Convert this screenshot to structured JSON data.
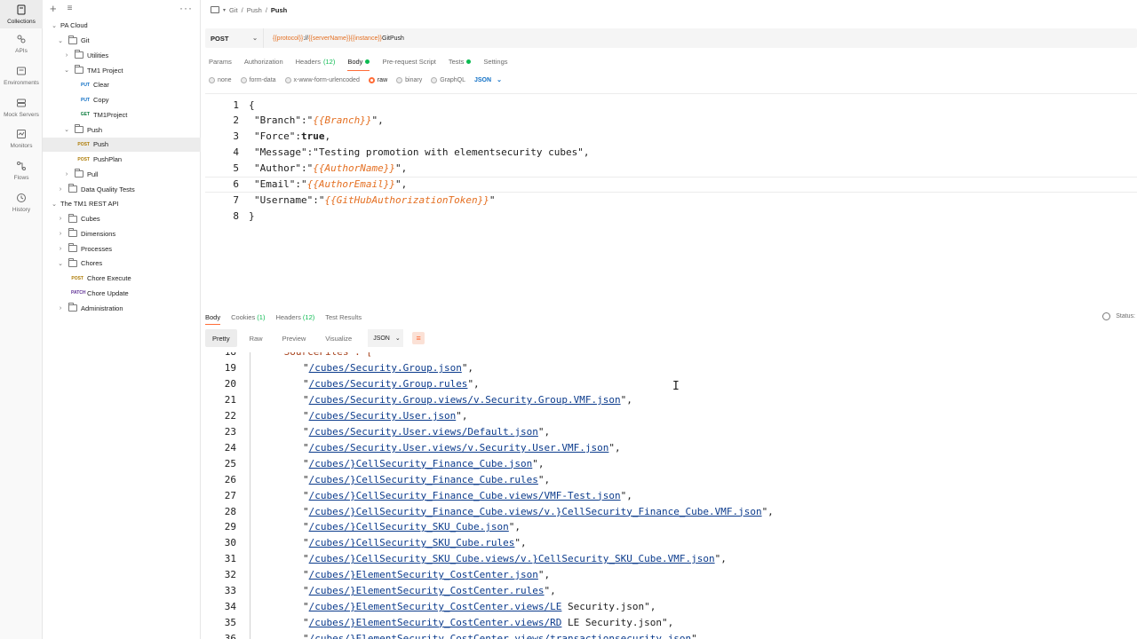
{
  "rail": {
    "items": [
      {
        "label": "Collections",
        "icon": "collections-icon"
      },
      {
        "label": "APIs",
        "icon": "apis-icon"
      },
      {
        "label": "Environments",
        "icon": "environments-icon"
      },
      {
        "label": "Mock Servers",
        "icon": "mock-servers-icon"
      },
      {
        "label": "Monitors",
        "icon": "monitors-icon"
      },
      {
        "label": "Flows",
        "icon": "flows-icon"
      },
      {
        "label": "History",
        "icon": "history-icon"
      }
    ]
  },
  "sidebar": {
    "tree": [
      {
        "label": "PA Cloud",
        "type": "collection",
        "depth": 0,
        "chevron": "v"
      },
      {
        "label": "Git",
        "type": "folder",
        "depth": 1,
        "chevron": "v"
      },
      {
        "label": "Utilities",
        "type": "folder",
        "depth": 2,
        "chevron": ">"
      },
      {
        "label": "TM1 Project",
        "type": "folder",
        "depth": 2,
        "chevron": "v"
      },
      {
        "label": "Clear",
        "type": "request",
        "method": "PUT",
        "depth": 3
      },
      {
        "label": "Copy",
        "type": "request",
        "method": "PUT",
        "depth": 3
      },
      {
        "label": "TM1Project",
        "type": "request",
        "method": "GET",
        "depth": 3
      },
      {
        "label": "Push",
        "type": "folder",
        "depth": 2,
        "chevron": "v"
      },
      {
        "label": "Push",
        "type": "request",
        "method": "POST",
        "depth": 3,
        "selected": true
      },
      {
        "label": "PushPlan",
        "type": "request",
        "method": "POST",
        "depth": 3
      },
      {
        "label": "Pull",
        "type": "folder",
        "depth": 2,
        "chevron": ">"
      },
      {
        "label": "Data Quality Tests",
        "type": "folder",
        "depth": 1,
        "chevron": ">"
      },
      {
        "label": "The TM1 REST API",
        "type": "collection",
        "depth": 0,
        "chevron": "v"
      },
      {
        "label": "Cubes",
        "type": "folder",
        "depth": 1,
        "chevron": ">"
      },
      {
        "label": "Dimensions",
        "type": "folder",
        "depth": 1,
        "chevron": ">"
      },
      {
        "label": "Processes",
        "type": "folder",
        "depth": 1,
        "chevron": ">"
      },
      {
        "label": "Chores",
        "type": "folder",
        "depth": 1,
        "chevron": "v"
      },
      {
        "label": "Chore Execute",
        "type": "request",
        "method": "POST",
        "depth": 2
      },
      {
        "label": "Chore Update",
        "type": "request",
        "method": "PATCH",
        "depth": 2
      },
      {
        "label": "Administration",
        "type": "folder",
        "depth": 1,
        "chevron": ">"
      }
    ]
  },
  "breadcrumb": {
    "part1": "Git",
    "sep": "/",
    "part2": "Push",
    "current": "Push"
  },
  "request": {
    "method": "POST",
    "url_parts": [
      {
        "text": "{{protocol}}",
        "var": true
      },
      {
        "text": "://",
        "var": false
      },
      {
        "text": "{{serverName}}",
        "var": true
      },
      {
        "text": "{{instance}}",
        "var": true
      },
      {
        "text": "GitPush",
        "var": false
      }
    ],
    "tabs": [
      {
        "label": "Params"
      },
      {
        "label": "Authorization"
      },
      {
        "label": "Headers",
        "count": "(12)"
      },
      {
        "label": "Body",
        "dot": true,
        "active": true
      },
      {
        "label": "Pre-request Script"
      },
      {
        "label": "Tests",
        "dot": true
      },
      {
        "label": "Settings"
      }
    ],
    "body_types": [
      "none",
      "form-data",
      "x-www-form-urlencoded",
      "raw",
      "binary",
      "GraphQL"
    ],
    "body_type_selected": "raw",
    "language": "JSON",
    "body_lines": [
      {
        "n": "1",
        "t": "{"
      },
      {
        "n": "2",
        "k": "\"Branch\"",
        "sep": ":",
        "q1": "\"",
        "v": "{{Branch}}",
        "q2": "\","
      },
      {
        "n": "3",
        "k": "\"Force\"",
        "sep": ":",
        "bool": "true",
        "end": ","
      },
      {
        "n": "4",
        "k": "\"Message\"",
        "sep": ":",
        "str": "\"Testing promotion with elementsecurity cubes\","
      },
      {
        "n": "5",
        "k": "\"Author\"",
        "sep": ":",
        "q1": "\"",
        "v": "{{AuthorName}}",
        "q2": "\","
      },
      {
        "n": "6",
        "k": "\"Email\"",
        "sep": ":",
        "q1": "\"",
        "v": "{{AuthorEmail}}",
        "q2": "\","
      },
      {
        "n": "7",
        "k": "\"Username\"",
        "sep": ":",
        "q1": "\"",
        "v": "{{GitHubAuthorizationToken}}",
        "q2": "\""
      },
      {
        "n": "8",
        "t": "}"
      }
    ]
  },
  "response": {
    "tabs": [
      {
        "label": "Body",
        "active": true
      },
      {
        "label": "Cookies",
        "count": "(1)"
      },
      {
        "label": "Headers",
        "count": "(12)"
      },
      {
        "label": "Test Results"
      }
    ],
    "status_label": "Status:",
    "views": [
      "Pretty",
      "Raw",
      "Preview",
      "Visualize"
    ],
    "view_selected": "Pretty",
    "format": "JSON",
    "first_line": {
      "n": "18",
      "t": "\"SourceFiles\": ["
    },
    "lines": [
      {
        "n": "19",
        "path": "/cubes/Security.Group.json",
        "end": "\","
      },
      {
        "n": "20",
        "path": "/cubes/Security.Group.rules",
        "end": "\","
      },
      {
        "n": "21",
        "path": "/cubes/Security.Group.views/v.Security.Group.VMF.json",
        "end": "\","
      },
      {
        "n": "22",
        "path": "/cubes/Security.User.json",
        "end": "\","
      },
      {
        "n": "23",
        "path": "/cubes/Security.User.views/Default.json",
        "end": "\","
      },
      {
        "n": "24",
        "path": "/cubes/Security.User.views/v.Security.User.VMF.json",
        "end": "\","
      },
      {
        "n": "25",
        "path": "/cubes/}CellSecurity_Finance_Cube.json",
        "end": "\","
      },
      {
        "n": "26",
        "path": "/cubes/}CellSecurity_Finance_Cube.rules",
        "end": "\","
      },
      {
        "n": "27",
        "path": "/cubes/}CellSecurity_Finance_Cube.views/VMF-Test.json",
        "end": "\","
      },
      {
        "n": "28",
        "path": "/cubes/}CellSecurity_Finance_Cube.views/v.}CellSecurity_Finance_Cube.VMF.json",
        "end": "\","
      },
      {
        "n": "29",
        "path": "/cubes/}CellSecurity_SKU_Cube.json",
        "end": "\","
      },
      {
        "n": "30",
        "path": "/cubes/}CellSecurity_SKU_Cube.rules",
        "end": "\","
      },
      {
        "n": "31",
        "path": "/cubes/}CellSecurity_SKU_Cube.views/v.}CellSecurity_SKU_Cube.VMF.json",
        "end": "\","
      },
      {
        "n": "32",
        "path": "/cubes/}ElementSecurity_CostCenter.json",
        "end": "\","
      },
      {
        "n": "33",
        "path": "/cubes/}ElementSecurity_CostCenter.rules",
        "end": "\","
      },
      {
        "n": "34",
        "path": "/cubes/}ElementSecurity_CostCenter.views/LE",
        "tail": " Security.json",
        "end": "\","
      },
      {
        "n": "35",
        "path": "/cubes/}ElementSecurity_CostCenter.views/RD",
        "tail": " LE Security.json",
        "end": "\","
      },
      {
        "n": "36",
        "path": "/cubes/}ElementSecurity_CostCenter.views/transactionsecurity.json",
        "end": "\","
      }
    ]
  },
  "colors": {
    "accent": "#ff6c37",
    "var": "#e46f21",
    "link": "#0b3b8c",
    "green": "#0cbb52"
  }
}
